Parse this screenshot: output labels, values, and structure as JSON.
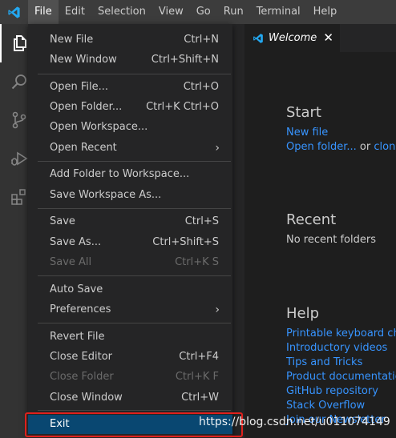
{
  "menubar": {
    "items": [
      "File",
      "Edit",
      "Selection",
      "View",
      "Go",
      "Run",
      "Terminal",
      "Help"
    ],
    "active": "File"
  },
  "activity_bar": {
    "icons": [
      "explorer-icon",
      "search-icon",
      "source-control-icon",
      "run-debug-icon",
      "extensions-icon"
    ]
  },
  "file_menu": {
    "items": [
      {
        "label": "New File",
        "shortcut": "Ctrl+N"
      },
      {
        "label": "New Window",
        "shortcut": "Ctrl+Shift+N"
      },
      {
        "label": "Open File...",
        "shortcut": "Ctrl+O"
      },
      {
        "label": "Open Folder...",
        "shortcut": "Ctrl+K Ctrl+O"
      },
      {
        "label": "Open Workspace...",
        "shortcut": ""
      },
      {
        "label": "Open Recent",
        "shortcut": ""
      },
      {
        "label": "Add Folder to Workspace...",
        "shortcut": ""
      },
      {
        "label": "Save Workspace As...",
        "shortcut": ""
      },
      {
        "label": "Save",
        "shortcut": "Ctrl+S"
      },
      {
        "label": "Save As...",
        "shortcut": "Ctrl+Shift+S"
      },
      {
        "label": "Save All",
        "shortcut": "Ctrl+K S"
      },
      {
        "label": "Auto Save",
        "shortcut": ""
      },
      {
        "label": "Preferences",
        "shortcut": ""
      },
      {
        "label": "Revert File",
        "shortcut": ""
      },
      {
        "label": "Close Editor",
        "shortcut": "Ctrl+F4"
      },
      {
        "label": "Close Folder",
        "shortcut": "Ctrl+K F"
      },
      {
        "label": "Close Window",
        "shortcut": "Ctrl+W"
      },
      {
        "label": "Exit",
        "shortcut": ""
      }
    ]
  },
  "tab": {
    "label": "Welcome",
    "close": "✕"
  },
  "welcome": {
    "start_title": "Start",
    "new_file": "New file",
    "open_folder": "Open folder...",
    "or": " or ",
    "clone": "clone re",
    "recent_title": "Recent",
    "no_recent": "No recent folders",
    "help_title": "Help",
    "help_links": [
      "Printable keyboard chea",
      "Introductory videos",
      "Tips and Tricks",
      "Product documentation",
      "GitHub repository",
      "Stack Overflow",
      "Join our Newsletter"
    ]
  },
  "watermark": "https://blog.csdn.net/u011074149",
  "colors": {
    "accent_selected": "#094771",
    "link": "#3794ff",
    "annotation_box": "#e0201c"
  }
}
